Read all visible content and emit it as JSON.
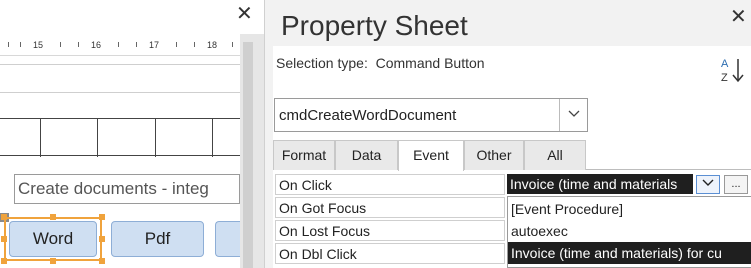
{
  "design": {
    "ruler_numbers": [
      "15",
      "16",
      "17",
      "18"
    ],
    "header_label": "Create documents - integ",
    "buttons": [
      "Word",
      "Pdf"
    ]
  },
  "property_sheet": {
    "title": "Property Sheet",
    "selection_type_label": "Selection type:",
    "selection_type_value": "Command Button",
    "object_name": "cmdCreateWordDocument",
    "tabs": [
      "Format",
      "Data",
      "Event",
      "Other",
      "All"
    ],
    "active_tab": "Event",
    "properties": [
      "On Click",
      "On Got Focus",
      "On Lost Focus",
      "On Dbl Click"
    ],
    "on_click_value": "Invoice (time and materials",
    "build_button_label": "...",
    "dropdown_options": [
      "[Event Procedure]",
      "autoexec",
      "Invoice (time and materials) for cu"
    ]
  },
  "colors": {
    "selection_orange": "#f0a33c",
    "button_fill": "#cfdff2",
    "highlight_dark": "#1f1f1f"
  },
  "icons": {
    "close": "close-icon",
    "sort": "sort-az-icon",
    "chevron": "chevron-down-icon"
  }
}
